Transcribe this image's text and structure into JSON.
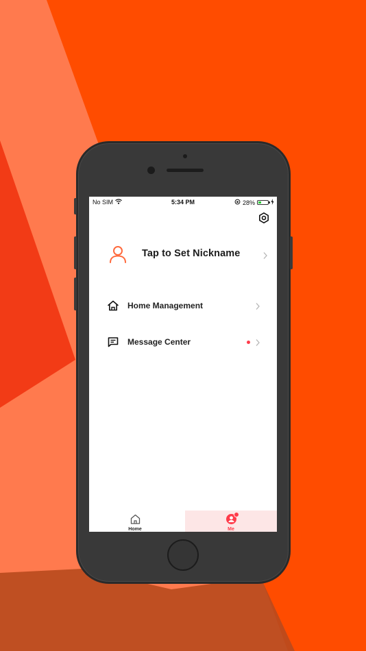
{
  "status_bar": {
    "carrier": "No SIM",
    "time": "5:34 PM",
    "battery": "28%",
    "battery_level": 0.28
  },
  "profile": {
    "nickname": "Tap to Set Nickname"
  },
  "menu": {
    "home_management": "Home Management",
    "message_center": "Message Center"
  },
  "tab_bar": {
    "home_label": "Home",
    "me_label": "Me"
  },
  "colors": {
    "accent": "#ff6a3d",
    "badge": "#ff3b4a",
    "background": "#ff4c00",
    "tab_active_bg": "#fde6e6"
  }
}
